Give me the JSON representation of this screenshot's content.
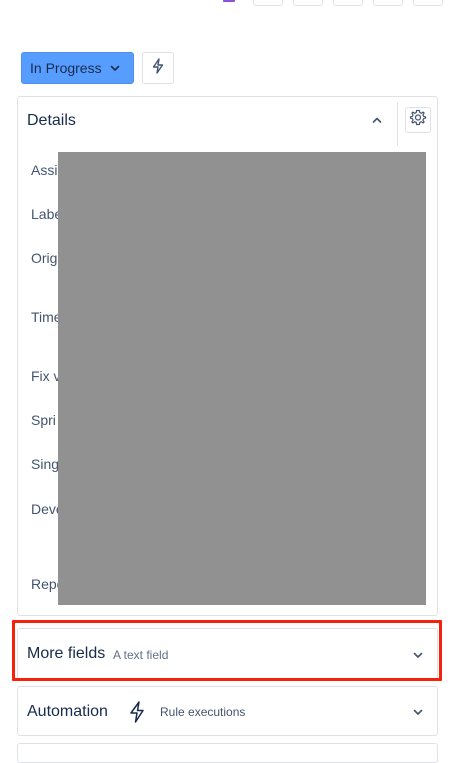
{
  "status": {
    "label": "In Progress"
  },
  "details": {
    "title": "Details",
    "fields": [
      "Assi",
      "Labe",
      "Orig",
      "Time",
      "Fix v",
      "Spri",
      "Sing",
      "Deve",
      "Repo"
    ]
  },
  "more_fields": {
    "title": "More fields",
    "subtitle": "A text field"
  },
  "automation": {
    "title": "Automation",
    "subtitle": "Rule executions"
  },
  "colors": {
    "status_bg": "#579dff",
    "highlight_border": "#f5210b",
    "redaction": "#919191"
  }
}
